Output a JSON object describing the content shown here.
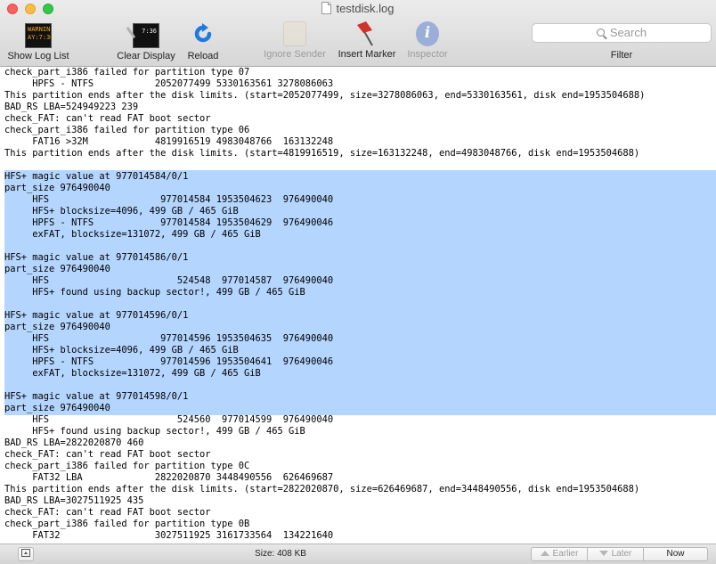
{
  "window": {
    "title": "testdisk.log"
  },
  "toolbar": {
    "show_log_list": "Show Log List",
    "show_log_list_icon_text": "WARNIN\nAY:7:36",
    "clear_display": "Clear Display",
    "clear_display_icon_text": "7:36",
    "reload": "Reload",
    "ignore_sender": "Ignore Sender",
    "insert_marker": "Insert Marker",
    "inspector": "Inspector",
    "search_placeholder": "Search",
    "filter": "Filter"
  },
  "colors": {
    "selection": "#b4d5fe",
    "reload_blue": "#1f7ae0",
    "marker_red": "#d0322a"
  },
  "log": {
    "lines": [
      "check_part_i386 failed for partition type 07",
      "     HPFS - NTFS           2052077499 5330163561 3278086063",
      "This partition ends after the disk limits. (start=2052077499, size=3278086063, end=5330163561, disk end=1953504688)",
      "BAD_RS LBA=524949223 239",
      "check_FAT: can't read FAT boot sector",
      "check_part_i386 failed for partition type 06",
      "     FAT16 >32M            4819916519 4983048766  163132248",
      "This partition ends after the disk limits. (start=4819916519, size=163132248, end=4983048766, disk end=1953504688)",
      "",
      "HFS+ magic value at 977014584/0/1",
      "part_size 976490040",
      "     HFS                    977014584 1953504623  976490040",
      "     HFS+ blocksize=4096, 499 GB / 465 GiB",
      "     HPFS - NTFS            977014584 1953504629  976490046",
      "     exFAT, blocksize=131072, 499 GB / 465 GiB",
      "",
      "HFS+ magic value at 977014586/0/1",
      "part_size 976490040",
      "     HFS                       524548  977014587  976490040",
      "     HFS+ found using backup sector!, 499 GB / 465 GiB",
      "",
      "HFS+ magic value at 977014596/0/1",
      "part_size 976490040",
      "     HFS                    977014596 1953504635  976490040",
      "     HFS+ blocksize=4096, 499 GB / 465 GiB",
      "     HPFS - NTFS            977014596 1953504641  976490046",
      "     exFAT, blocksize=131072, 499 GB / 465 GiB",
      "",
      "HFS+ magic value at 977014598/0/1",
      "part_size 976490040",
      "     HFS                       524560  977014599  976490040",
      "     HFS+ found using backup sector!, 499 GB / 465 GiB",
      "BAD_RS LBA=2822020870 460",
      "check_FAT: can't read FAT boot sector",
      "check_part_i386 failed for partition type 0C",
      "     FAT32 LBA             2822020870 3448490556  626469687",
      "This partition ends after the disk limits. (start=2822020870, size=626469687, end=3448490556, disk end=1953504688)",
      "BAD_RS LBA=3027511925 435",
      "check_FAT: can't read FAT boot sector",
      "check_part_i386 failed for partition type 0B",
      "     FAT32                 3027511925 3161733564  134221640"
    ],
    "selection": {
      "first_line": 9,
      "last_line": 29
    }
  },
  "status": {
    "size": "Size: 408 KB",
    "earlier": "Earlier",
    "later": "Later",
    "now": "Now"
  }
}
